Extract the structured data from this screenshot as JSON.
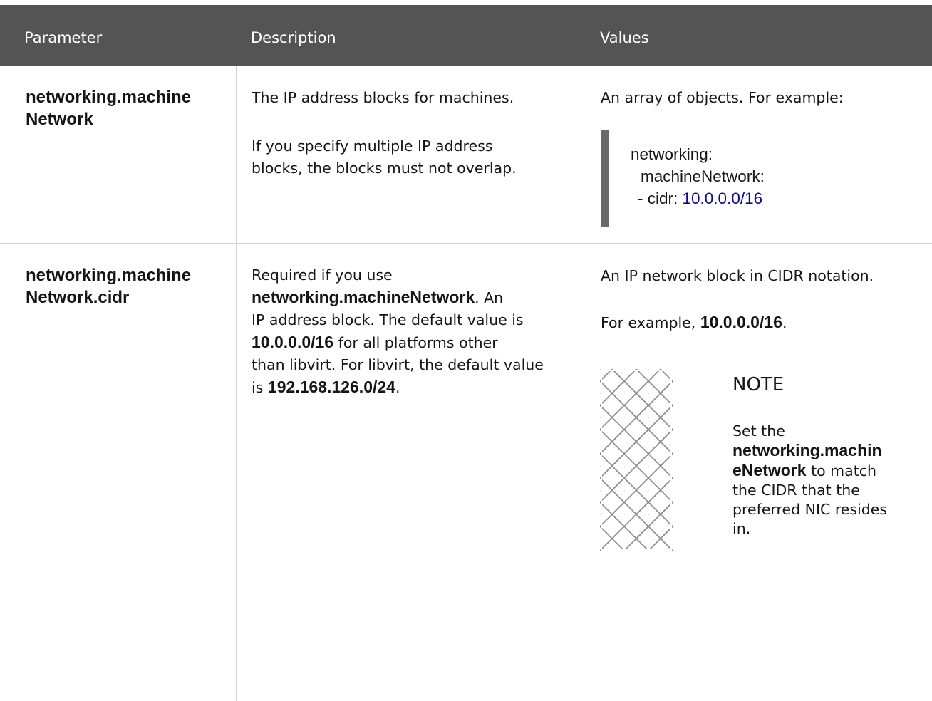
{
  "table": {
    "headers": [
      "Parameter",
      "Description",
      "Values"
    ],
    "rows": [
      {
        "parameter": [
          "networking.machine",
          "Network"
        ],
        "description": {
          "p1": "The IP address blocks for machines.",
          "p2_line1": "If you specify multiple IP address",
          "p2_line2": "blocks, the blocks must not overlap."
        },
        "values": {
          "intro": "An array of objects. For example:",
          "code": {
            "line1": "networking:",
            "line2": "machineNetwork:",
            "line3_prefix": "- cidr: ",
            "line3_value": "10.0.0.0/16"
          }
        }
      },
      {
        "parameter": [
          "networking.machine",
          "Network.cidr"
        ],
        "description": {
          "l1": "Required if you use",
          "l2_bold": "networking.machineNetwork",
          "l2_rest": ". An",
          "l3": "IP address block. The default value is",
          "l4_bold": "10.0.0.0/16",
          "l4_rest": " for all platforms other",
          "l5": "than libvirt. For libvirt, the default value",
          "l6_pre": "is ",
          "l6_bold": "192.168.126.0/24",
          "l6_rest": "."
        },
        "values": {
          "p1": "An IP network block in CIDR notation.",
          "p2_pre": "For example, ",
          "p2_bold": "10.0.0.0/16",
          "p2_rest": ".",
          "note": {
            "icon": "note-pattern-icon",
            "title": "NOTE",
            "l1": "Set the",
            "l2_bold": "networking.machin",
            "l3_bold": "eNetwork",
            "l3_rest": " to match",
            "l4": "the CIDR that the",
            "l5": "preferred NIC resides",
            "l6": "in."
          }
        }
      }
    ]
  },
  "colors": {
    "header_bg": "#545454",
    "code_bar": "#6a6a6a",
    "code_number": "#0b0b8f"
  }
}
